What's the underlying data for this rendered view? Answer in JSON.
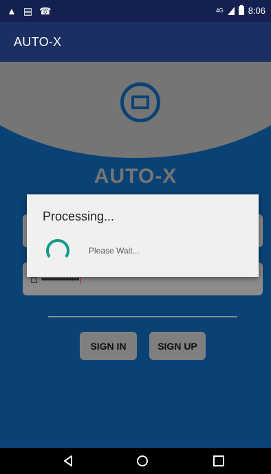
{
  "status_bar": {
    "left_icons": [
      "alert-icon",
      "message-icon",
      "missed-call-icon"
    ],
    "network": "4G",
    "time": "8:06"
  },
  "toolbar": {
    "title": "AUTO-X"
  },
  "login": {
    "app_name": "AUTO-X",
    "password_masked": "••••••••••••••",
    "signin_label": "SIGN IN",
    "signup_label": "SIGN UP"
  },
  "dialog": {
    "title": "Processing...",
    "message": "Please Wait..."
  },
  "colors": {
    "status_bar": "#142150",
    "toolbar": "#1b2f63",
    "background": "#0b4275",
    "header_curve": "#757575",
    "spinner": "#12998a",
    "dialog": "#f0f0f0"
  }
}
